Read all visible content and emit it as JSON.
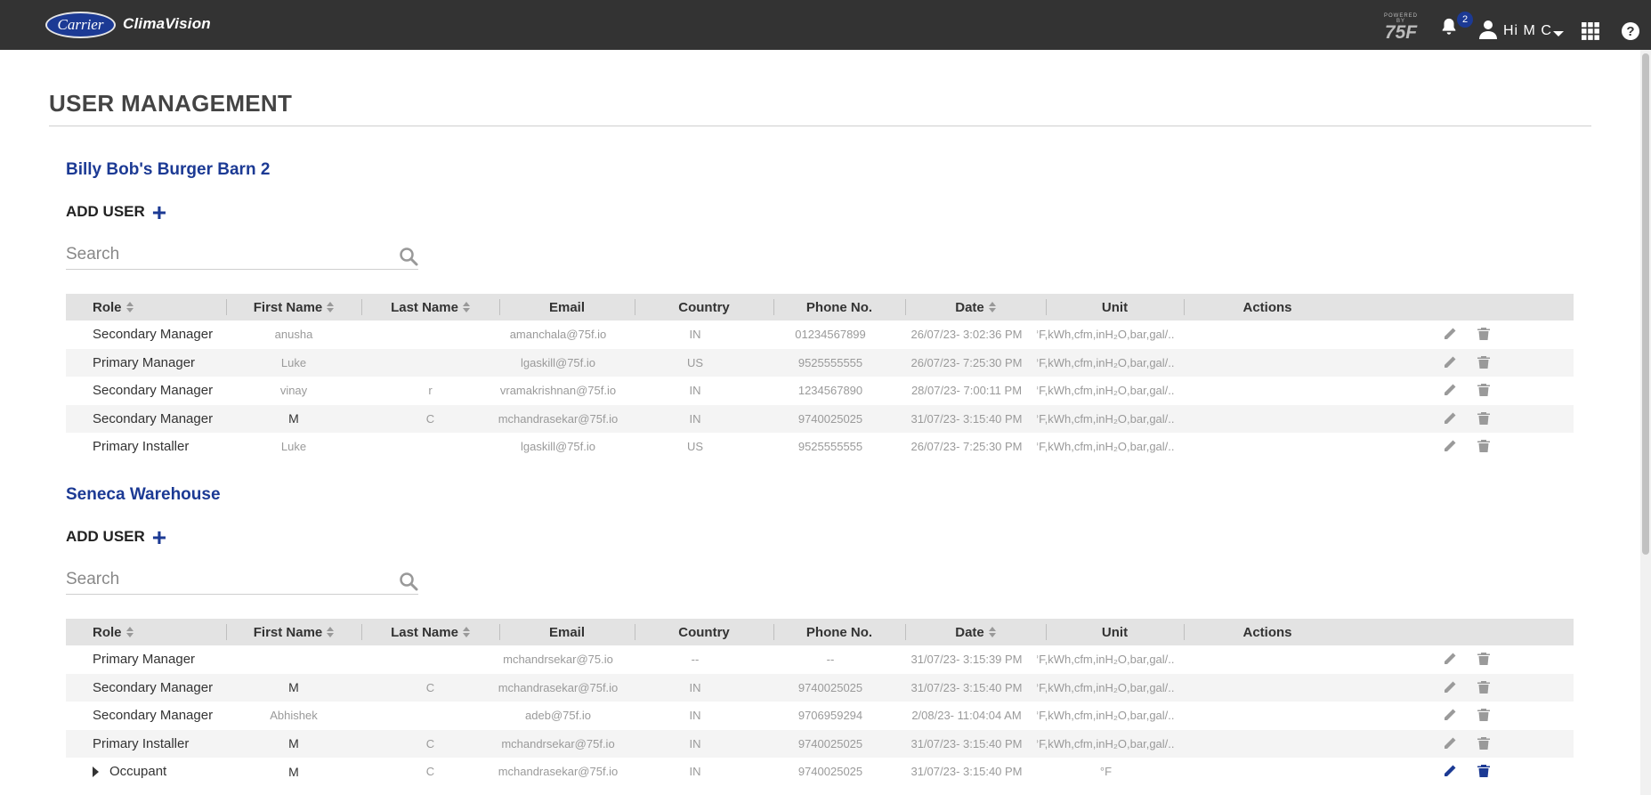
{
  "header": {
    "logo_text": "Carrier",
    "product_name": "ClimaVision",
    "powered_by_small": "POWERED BY",
    "powered_by_big": "75F",
    "notification_count": "2",
    "greeting": "Hi M C",
    "help_label": "?"
  },
  "page": {
    "title": "USER MANAGEMENT"
  },
  "columns": [
    "Role",
    "First Name",
    "Last Name",
    "Email",
    "Country",
    "Phone No.",
    "Date",
    "Unit",
    "Actions"
  ],
  "sites": [
    {
      "name": "Billy Bob's Burger Barn 2",
      "add_user_label": "ADD USER",
      "search_placeholder": "Search",
      "rows": [
        {
          "role": "Secondary Manager",
          "first": "anusha",
          "last": "",
          "email": "amanchala@75f.io",
          "country": "IN",
          "phone": "01234567899",
          "date": "26/07/23- 3:02:36 PM",
          "unit": "°F,kWh,cfm,inH₂O,bar,gal/..."
        },
        {
          "role": "Primary Manager",
          "first": "Luke",
          "last": "",
          "email": "lgaskill@75f.io",
          "country": "US",
          "phone": "9525555555",
          "date": "26/07/23- 7:25:30 PM",
          "unit": "°F,kWh,cfm,inH₂O,bar,gal/..."
        },
        {
          "role": "Secondary Manager",
          "first": "vinay",
          "last": "r",
          "email": "vramakrishnan@75f.io",
          "country": "IN",
          "phone": "1234567890",
          "date": "28/07/23- 7:00:11 PM",
          "unit": "°F,kWh,cfm,inH₂O,bar,gal/..."
        },
        {
          "role": "Secondary Manager",
          "first": "M",
          "last": "C",
          "email": "mchandrasekar@75f.io",
          "country": "IN",
          "phone": "9740025025",
          "date": "31/07/23- 3:15:40 PM",
          "unit": "°F,kWh,cfm,inH₂O,bar,gal/..."
        },
        {
          "role": "Primary Installer",
          "first": "Luke",
          "last": "",
          "email": "lgaskill@75f.io",
          "country": "US",
          "phone": "9525555555",
          "date": "26/07/23- 7:25:30 PM",
          "unit": "°F,kWh,cfm,inH₂O,bar,gal/..."
        }
      ]
    },
    {
      "name": "Seneca Warehouse",
      "add_user_label": "ADD USER",
      "search_placeholder": "Search",
      "rows": [
        {
          "role": "Primary Manager",
          "first": "",
          "last": "",
          "email": "mchandrsekar@75.io",
          "country": "--",
          "phone": "--",
          "date": "31/07/23- 3:15:39 PM",
          "unit": "°F,kWh,cfm,inH₂O,bar,gal/..."
        },
        {
          "role": "Secondary Manager",
          "first": "M",
          "last": "C",
          "email": "mchandrasekar@75f.io",
          "country": "IN",
          "phone": "9740025025",
          "date": "31/07/23- 3:15:40 PM",
          "unit": "°F,kWh,cfm,inH₂O,bar,gal/..."
        },
        {
          "role": "Secondary Manager",
          "first": "Abhishek",
          "last": "",
          "email": "adeb@75f.io",
          "country": "IN",
          "phone": "9706959294",
          "date": "2/08/23- 11:04:04 AM",
          "unit": "°F,kWh,cfm,inH₂O,bar,gal/..."
        },
        {
          "role": "Primary Installer",
          "first": "M",
          "last": "C",
          "email": "mchandrsekar@75f.io",
          "country": "IN",
          "phone": "9740025025",
          "date": "31/07/23- 3:15:40 PM",
          "unit": "°F,kWh,cfm,inH₂O,bar,gal/..."
        },
        {
          "role": "Occupant",
          "first": "M",
          "last": "C",
          "email": "mchandrasekar@75f.io",
          "country": "IN",
          "phone": "9740025025",
          "date": "31/07/23- 3:15:40 PM",
          "unit": "°F"
        }
      ]
    }
  ],
  "colors": {
    "topbar": "#333333",
    "brand_blue": "#1c3a94",
    "header_row": "#e3e3e3",
    "alt_row": "#f4f4f4"
  },
  "icons": [
    "bell-icon",
    "user-icon",
    "apps-grid-icon",
    "help-icon",
    "search-icon",
    "sort-icon",
    "edit-pencil-icon",
    "trash-icon",
    "expand-arrow-icon"
  ]
}
